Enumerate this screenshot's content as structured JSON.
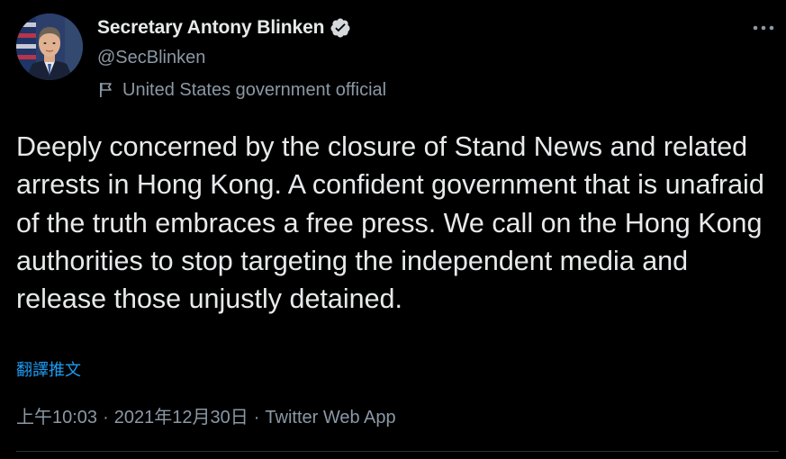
{
  "tweet": {
    "author": {
      "display_name": "Secretary Antony Blinken",
      "handle": "@SecBlinken",
      "label": "United States government official",
      "verified": true
    },
    "text": "Deeply concerned by the closure of Stand News and related arrests in Hong Kong. A confident government that is unafraid of the truth embraces a free press. We call on the Hong Kong authorities to stop targeting the independent media and release those unjustly detained.",
    "translate_label": "翻譯推文",
    "meta": {
      "time": "上午10:03",
      "separator": "·",
      "date": "2021年12月30日",
      "source": "Twitter Web App"
    }
  },
  "colors": {
    "background": "#000000",
    "text_primary": "#e7e9ea",
    "text_secondary": "#8b98a5",
    "link": "#1d9bf0",
    "divider": "#2f3336"
  },
  "icons": {
    "verified": "verified-badge-icon",
    "label": "government-flag-icon",
    "more": "more-horizontal-icon"
  }
}
